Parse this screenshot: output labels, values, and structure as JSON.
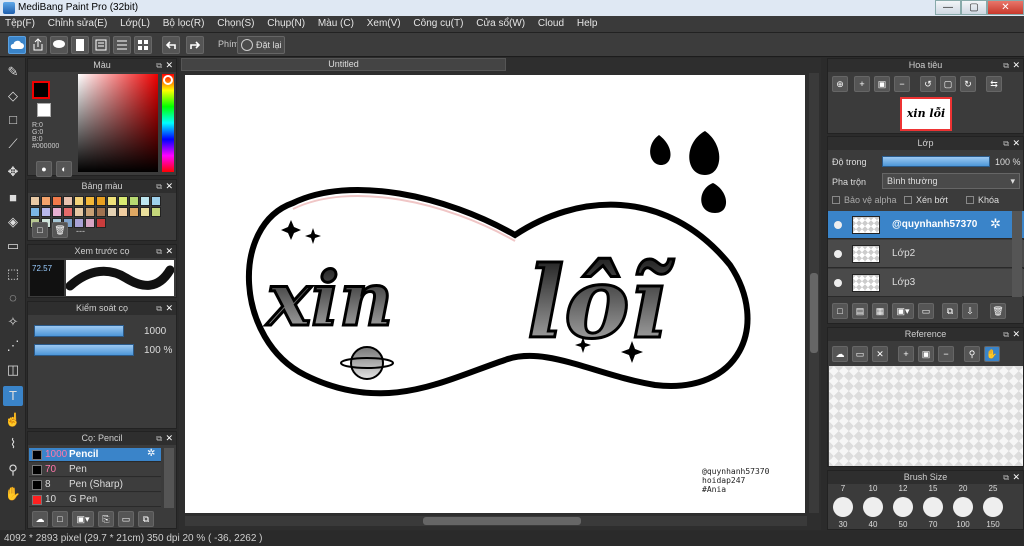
{
  "window": {
    "title": "MediBang Paint Pro (32bit)",
    "minimize": "—",
    "maximize": "▢",
    "close": "✕"
  },
  "menu": [
    "Tệp(F)",
    "Chỉnh sửa(E)",
    "Lớp(L)",
    "Bộ lọc(R)",
    "Chọn(S)",
    "Chụp(N)",
    "Màu (C)",
    "Xem(V)",
    "Công cụ(T)",
    "Cửa sổ(W)",
    "Cloud",
    "Help"
  ],
  "toolbar": {
    "shortcut_label": "Phím",
    "reset_label": "Đặt lại"
  },
  "color_panel": {
    "title": "Màu",
    "r": "R:0",
    "g": "G:0",
    "b": "B:0",
    "hex": "#000000"
  },
  "palette_panel": {
    "title": "Bảng màu",
    "dash": "---",
    "colors": [
      "#e8c9a5",
      "#f4a36b",
      "#f27a4a",
      "#e8c2b0",
      "#f3d37b",
      "#f4b838",
      "#e9a020",
      "#f0e27a",
      "#d9ea72",
      "#b7d972",
      "#bde6ef",
      "#9ed1ec",
      "#7ab5e4",
      "#b7b7ea",
      "#e8b1d2",
      "#e46a6a",
      "#e6c7a4",
      "#c99f74",
      "#a07250",
      "#e4d2b4",
      "#f0cda0",
      "#dfa863",
      "#eadf9b",
      "#c4d67a",
      "#b8c892",
      "#cfe3da",
      "#a6c7d6",
      "#7fa1c9",
      "#a9a2d6",
      "#d7a4c3",
      "#c93c3c"
    ]
  },
  "brush_preview": {
    "title": "Xem trước cọ",
    "size_label": "72.57"
  },
  "brush_control": {
    "title": "Kiểm soát cọ",
    "size": "1000",
    "opacity": "100 %",
    "size_fraction": 0.9,
    "opacity_fraction": 1.0
  },
  "brush_panel": {
    "title": "Cọ: Pencil",
    "items": [
      {
        "size": "1000",
        "name": "Pencil",
        "color": "#000000",
        "selected": true
      },
      {
        "size": "70",
        "name": "Pen",
        "color": "#000000",
        "selected": false
      },
      {
        "size": "8",
        "name": "Pen (Sharp)",
        "color": "#000000",
        "selected": false
      },
      {
        "size": "10",
        "name": "G Pen",
        "color": "#ff2020",
        "selected": false
      }
    ]
  },
  "canvas": {
    "tab": "Untitled",
    "watermark": [
      "@quynhanh57370",
      "hoidap247",
      "#Ania"
    ]
  },
  "navigator": {
    "title": "Hoa tiêu",
    "thumb_text": "xin lỗi"
  },
  "layer_panel": {
    "title": "Lớp",
    "opacity_label": "Độ trong",
    "opacity_value": "100 %",
    "blend_label": "Pha trộn",
    "blend_value": "Bình thường",
    "protect_alpha": "Bảo vệ alpha",
    "clip": "Xén bớt",
    "lock": "Khóa",
    "layers": [
      {
        "name": "@quynhanh57370",
        "selected": true
      },
      {
        "name": "Lớp2",
        "selected": false
      },
      {
        "name": "Lớp3",
        "selected": false
      }
    ]
  },
  "reference_panel": {
    "title": "Reference"
  },
  "brush_size_panel": {
    "title": "Brush Size",
    "top_sizes": [
      "7",
      "10",
      "12",
      "15",
      "20",
      "25"
    ],
    "sizes": [
      "30",
      "40",
      "50",
      "70",
      "100",
      "150"
    ]
  },
  "status": {
    "text": "4092 * 2893 pixel   (29.7 * 21cm)   350 dpi   20 %   ( -36, 2262 )"
  },
  "colors": {
    "accent": "#3a84c9",
    "primary_color": "#000000"
  }
}
